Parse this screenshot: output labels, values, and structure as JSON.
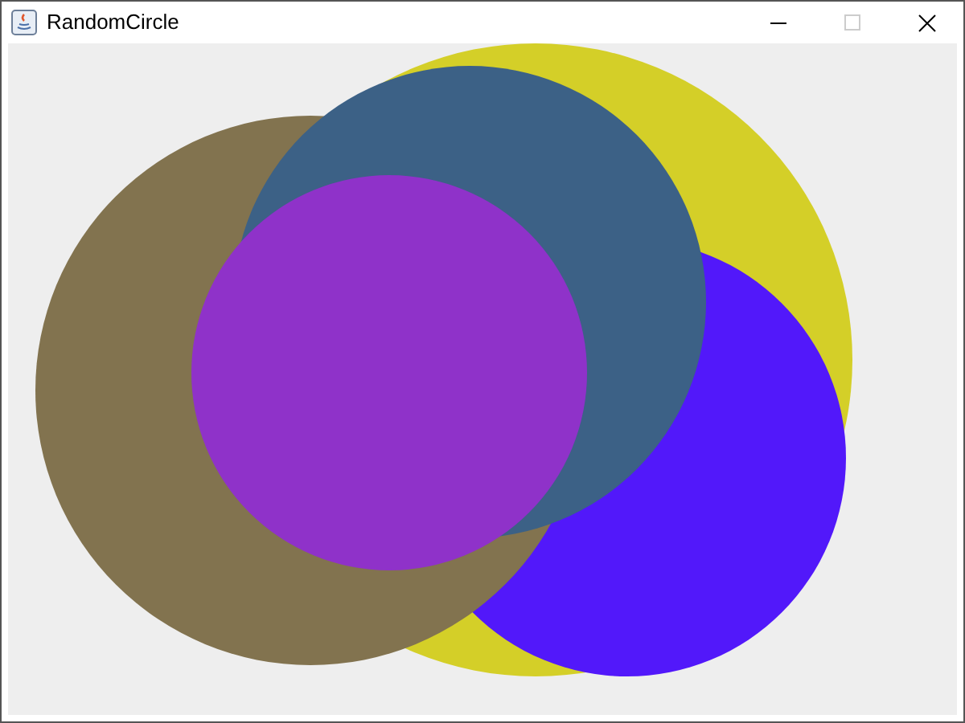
{
  "window": {
    "title": "RandomCircle",
    "maximize_disabled": true
  },
  "circles": [
    {
      "color": "#d4cf28"
    },
    {
      "color": "#5218fa"
    },
    {
      "color": "#82734f"
    },
    {
      "color": "#3c6186"
    },
    {
      "color": "#8f32c9"
    }
  ]
}
